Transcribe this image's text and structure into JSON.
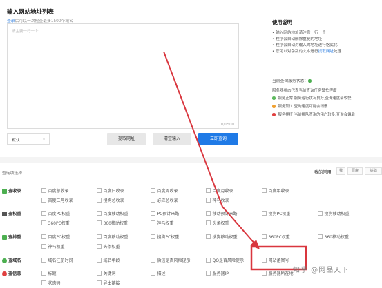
{
  "header": {
    "title": "输入网站地址列表",
    "login_link": "登录",
    "subline_rest": "后可以一次检查最多1500个域名"
  },
  "input": {
    "placeholder": "请主要一行一个",
    "counter": "0/1500"
  },
  "controls": {
    "select_value": "默认",
    "extract_label": "提取网址",
    "clear_label": "清空输入",
    "query_label": "立即查询"
  },
  "help": {
    "title": "使用说明",
    "items": [
      "输入网站地址请注意一行一个",
      "程序会自动删除重复的地址",
      "程序会自动对输入的地址进行格式化"
    ],
    "last_prefix": "您可以对杂乱的文本进行",
    "last_link": "提取网址",
    "last_suffix": "处理"
  },
  "status": {
    "label": "当前查询服务状态：",
    "legend_title": "服务器状态代表当前查询任务繁忙程度",
    "legend": [
      {
        "text": "服务正常 服务运行状况良好,查询速度会较快",
        "color": "#5cb85c"
      },
      {
        "text": "服务繁忙 查询速度可能会稍慢",
        "color": "#f0a030"
      },
      {
        "text": "服务拥挤 当前排队查询的用户较多,查询会偏后",
        "color": "#e04040"
      }
    ],
    "ok_color": "#4caf50"
  },
  "query_options": {
    "title": "查询项选择",
    "my_common": "我的常用",
    "tabs": [
      "我",
      "百度",
      "基础"
    ],
    "rows": [
      {
        "label": "查收录",
        "icon_color": "#4caf50",
        "opts": [
          "百度总收录",
          "百度日收录",
          "百度周收录",
          "百度月收录",
          "百度年收录",
          "百度三月收录",
          "搜狗总收录",
          "必应总收录",
          "神马收录"
        ]
      },
      {
        "label": "查权重",
        "icon_color": "#555555",
        "opts": [
          "百度PC权重",
          "百度移动权重",
          "PC预计来路",
          "移动预计来路",
          "搜狗PC权重",
          "搜狗移动权重",
          "360PC权重",
          "360移动权重",
          "神马权重",
          "头条权重"
        ]
      },
      {
        "label": "查排重",
        "icon_color": "#4caf50",
        "opts": [
          "百度PC权重",
          "百度移动权重",
          "搜狗PC权重",
          "搜狗移动权重",
          "360PC权重",
          "360移动权重",
          "神马权重",
          "头条权重"
        ]
      },
      {
        "label": "查域名",
        "icon_color": "#4caf50",
        "opts": [
          "域名注册时间",
          "域名年龄",
          "微信是否风险提示",
          "QQ是否风险提示",
          "网站备案号"
        ]
      },
      {
        "label": "查信息",
        "icon_color": "#e04040",
        "opts": [
          "标题",
          "关键词",
          "描述",
          "服务器IP",
          "服务器所在地",
          "状态码",
          "导出链接"
        ]
      }
    ]
  },
  "watermark": "知乎 @网品天下",
  "accent": "#1f7ae6",
  "annotation_color": "#d9363e"
}
